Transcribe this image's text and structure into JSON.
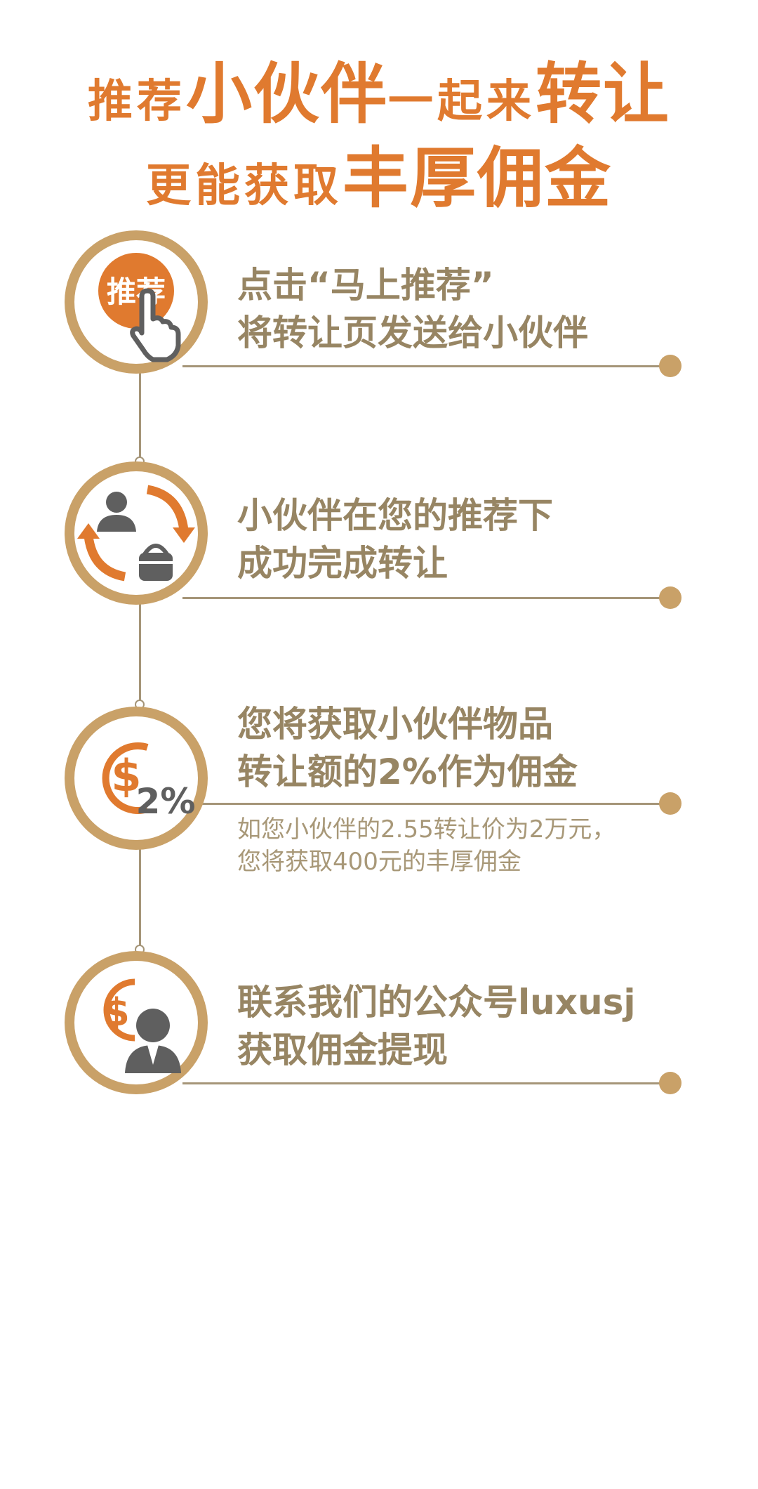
{
  "header": {
    "line1": [
      {
        "text": "推荐",
        "size": "small"
      },
      {
        "text": "小伙伴",
        "size": "big"
      },
      {
        "text": "一起来",
        "size": "small"
      },
      {
        "text": "转让",
        "size": "big"
      }
    ],
    "line2": [
      {
        "text": "更能获取",
        "size": "small"
      },
      {
        "text": "丰厚佣金",
        "size": "big"
      }
    ]
  },
  "steps": [
    {
      "icon": "recommend-hand-icon",
      "icon_label": "推荐",
      "line1": "点击“马上推荐”",
      "line2": "将转让页发送给小伙伴"
    },
    {
      "icon": "exchange-cycle-icon",
      "line1": "小伙伴在您的推荐下",
      "line2": "成功完成转让"
    },
    {
      "icon": "dollar-percent-icon",
      "icon_label": "2%",
      "line1": "您将获取小伙伴物品",
      "line2": "转让额的2%作为佣金",
      "note1": "如您小伙伴的2.55转让价为2万元，",
      "note2": "您将获取400元的丰厚佣金"
    },
    {
      "icon": "dollar-person-icon",
      "line1": "联系我们的公众号luxusj",
      "line2": "获取佣金提现"
    }
  ],
  "colors": {
    "accent": "#e07a2f",
    "gold": "#c9a168",
    "text": "#978563",
    "line": "#a59578",
    "icon_gray": "#5f5f5f"
  }
}
